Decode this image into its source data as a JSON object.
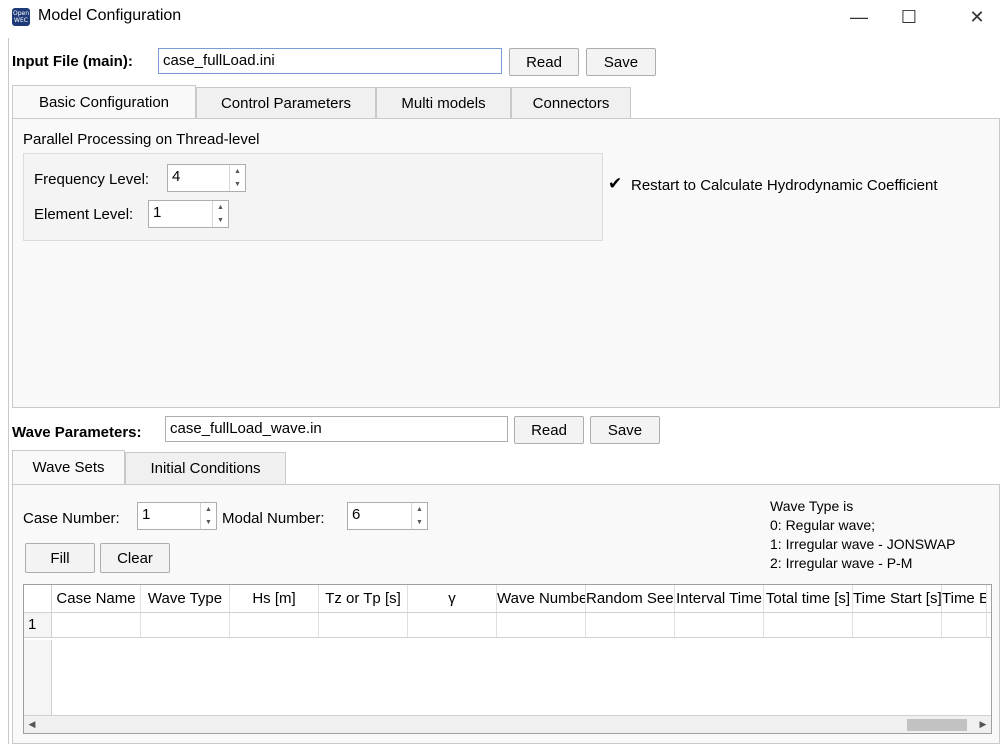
{
  "window": {
    "title": "Model Configuration",
    "icon_text": "Open WEC"
  },
  "input_file": {
    "label": "Input File (main):",
    "value": "case_fullLoad.ini",
    "read": "Read",
    "save": "Save"
  },
  "main_tabs": [
    "Basic Configuration",
    "Control Parameters",
    "Multi models",
    "Connectors"
  ],
  "basic": {
    "section_title": "Parallel Processing on Thread-level",
    "frequency_label": "Frequency Level:",
    "frequency_value": "4",
    "element_label": "Element Level:",
    "element_value": "1",
    "restart_label": "Restart to Calculate Hydrodynamic Coefficient",
    "restart_checked": true
  },
  "wave_params": {
    "label": "Wave Parameters:",
    "value": "case_fullLoad_wave.in",
    "read": "Read",
    "save": "Save"
  },
  "wave_tabs": [
    "Wave Sets",
    "Initial Conditions"
  ],
  "wave_sets": {
    "case_number_label": "Case Number:",
    "case_number_value": "1",
    "modal_number_label": "Modal Number:",
    "modal_number_value": "6",
    "fill": "Fill",
    "clear": "Clear",
    "wave_type_info": [
      "Wave Type is",
      "0: Regular wave;",
      "1: Irregular wave - JONSWAP",
      "2: Irregular wave - P-M"
    ]
  },
  "table": {
    "columns": [
      "Case Name",
      "Wave Type",
      "Hs [m]",
      "Tz or Tp [s]",
      "γ",
      "Wave Number",
      "Random Seed",
      "Interval Time",
      "Total time [s]",
      "Time Start [s]",
      "Time End"
    ],
    "rows": [
      "1"
    ]
  }
}
